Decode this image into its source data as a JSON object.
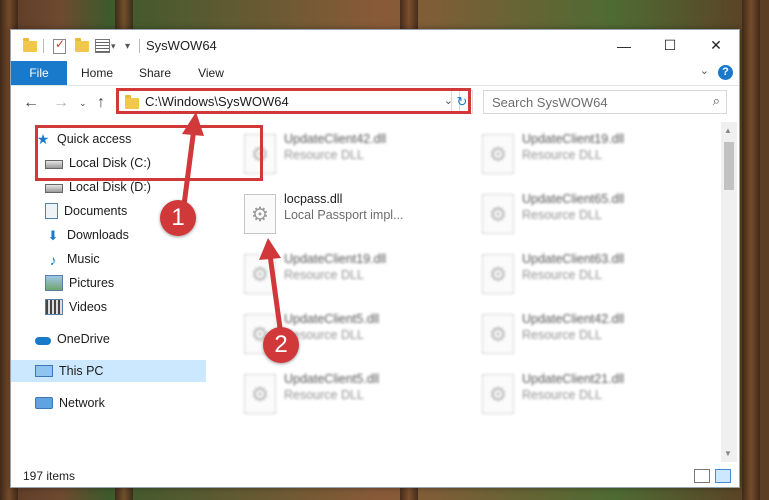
{
  "window": {
    "title": "SysWOW64",
    "minimize": "—",
    "maximize": "☐",
    "close": "✕"
  },
  "ribbon": {
    "tabs": [
      "File",
      "Home",
      "Share",
      "View"
    ],
    "help": "?"
  },
  "address": {
    "path": "C:\\Windows\\SysWOW64",
    "search_placeholder": "Search SysWOW64"
  },
  "navpane": {
    "items": [
      {
        "label": "Quick access",
        "icon": "star-icon"
      },
      {
        "label": "Local Disk (C:)",
        "icon": "drive-icon",
        "pinned": true
      },
      {
        "label": "Local Disk (D:)",
        "icon": "drive-icon",
        "pinned": true
      },
      {
        "label": "Documents",
        "icon": "documents-icon",
        "pinned": true
      },
      {
        "label": "Downloads",
        "icon": "downloads-icon",
        "pinned": true
      },
      {
        "label": "Music",
        "icon": "music-icon",
        "pinned": true
      },
      {
        "label": "Pictures",
        "icon": "pictures-icon",
        "pinned": true
      },
      {
        "label": "Videos",
        "icon": "videos-icon",
        "pinned": true
      },
      {
        "label": "OneDrive",
        "icon": "onedrive-icon"
      },
      {
        "label": "This PC",
        "icon": "this-pc-icon",
        "selected": true
      },
      {
        "label": "Network",
        "icon": "network-icon"
      }
    ]
  },
  "files": [
    {
      "name": "UpdateClient42.dll",
      "type": "Resource DLL",
      "blurred": true
    },
    {
      "name": "UpdateClient19.dll",
      "type": "Resource DLL",
      "blurred": true
    },
    {
      "name": "locpass.dll",
      "type": "Local Passport impl...",
      "blurred": false
    },
    {
      "name": "UpdateClient65.dll",
      "type": "Resource DLL",
      "blurred": true
    },
    {
      "name": "UpdateClient19.dll",
      "type": "Resource DLL",
      "blurred": true
    },
    {
      "name": "UpdateClient63.dll",
      "type": "Resource DLL",
      "blurred": true
    },
    {
      "name": "UpdateClient5.dll",
      "type": "Resource DLL",
      "blurred": true
    },
    {
      "name": "UpdateClient42.dll",
      "type": "Resource DLL",
      "blurred": true
    },
    {
      "name": "UpdateClient5.dll",
      "type": "Resource DLL",
      "blurred": true
    },
    {
      "name": "UpdateClient21.dll",
      "type": "Resource DLL",
      "blurred": true
    }
  ],
  "status": {
    "item_count": "197 items"
  },
  "annotations": {
    "step1": "1",
    "step2": "2",
    "color": "#d0383a"
  }
}
